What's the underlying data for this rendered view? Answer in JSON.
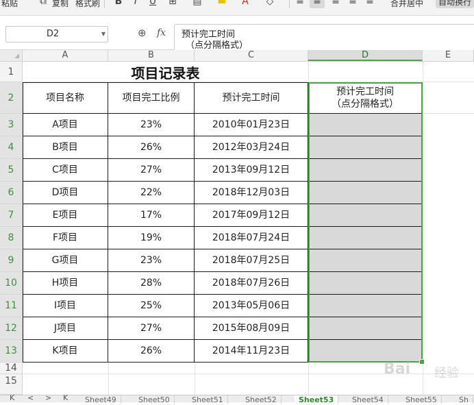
{
  "ribbon": {
    "paste": "粘贴",
    "copy": "复制",
    "format_painter": "格式刷",
    "merge_center": "合并居中",
    "wrap_text": "自动换行"
  },
  "formula_bar": {
    "name_box": "D2",
    "fx": "fx",
    "content_line1": "预计完工时间",
    "content_line2": "（点分隔格式）"
  },
  "columns": [
    "A",
    "B",
    "C",
    "D",
    "E"
  ],
  "active_column": "D",
  "rows": [
    "1",
    "2",
    "3",
    "4",
    "5",
    "6",
    "7",
    "8",
    "9",
    "10",
    "11",
    "12",
    "13",
    "14",
    "15"
  ],
  "sheet": {
    "title": "项目记录表",
    "headers": {
      "a": "项目名称",
      "b": "项目完工比例",
      "c": "预计完工时间",
      "d_line1": "预计完工时间",
      "d_line2": "（点分隔格式）"
    },
    "records": [
      {
        "name": "A项目",
        "ratio": "23%",
        "date": "2010年01月23日",
        "dot": ""
      },
      {
        "name": "B项目",
        "ratio": "26%",
        "date": "2012年03月24日",
        "dot": ""
      },
      {
        "name": "C项目",
        "ratio": "27%",
        "date": "2013年09月12日",
        "dot": ""
      },
      {
        "name": "D项目",
        "ratio": "22%",
        "date": "2018年12月03日",
        "dot": ""
      },
      {
        "name": "E项目",
        "ratio": "17%",
        "date": "2017年09月12日",
        "dot": ""
      },
      {
        "name": "F项目",
        "ratio": "19%",
        "date": "2018年07月24日",
        "dot": ""
      },
      {
        "name": "G项目",
        "ratio": "23%",
        "date": "2018年07月25日",
        "dot": ""
      },
      {
        "name": "H项目",
        "ratio": "28%",
        "date": "2018年07月26日",
        "dot": ""
      },
      {
        "name": "I项目",
        "ratio": "25%",
        "date": "2013年05月06日",
        "dot": ""
      },
      {
        "name": "J项目",
        "ratio": "27%",
        "date": "2015年08月09日",
        "dot": ""
      },
      {
        "name": "K项目",
        "ratio": "26%",
        "date": "2014年11月23日",
        "dot": ""
      }
    ]
  },
  "tabs": {
    "nav_first": "K",
    "nav_prev": "<",
    "nav_next": ">",
    "nav_last": "K",
    "items": [
      "Sheet49",
      "Sheet50",
      "Sheet51",
      "Sheet52",
      "Sheet53",
      "Sheet54",
      "Sheet55",
      "Sh"
    ],
    "active_index": 4
  },
  "watermark": {
    "brand": "Bai",
    "suffix": "经验"
  },
  "colors": {
    "selection": "#4ea24e",
    "fill_grey": "#d9d9d9",
    "ribbon_bg": "#f3f3f3"
  }
}
